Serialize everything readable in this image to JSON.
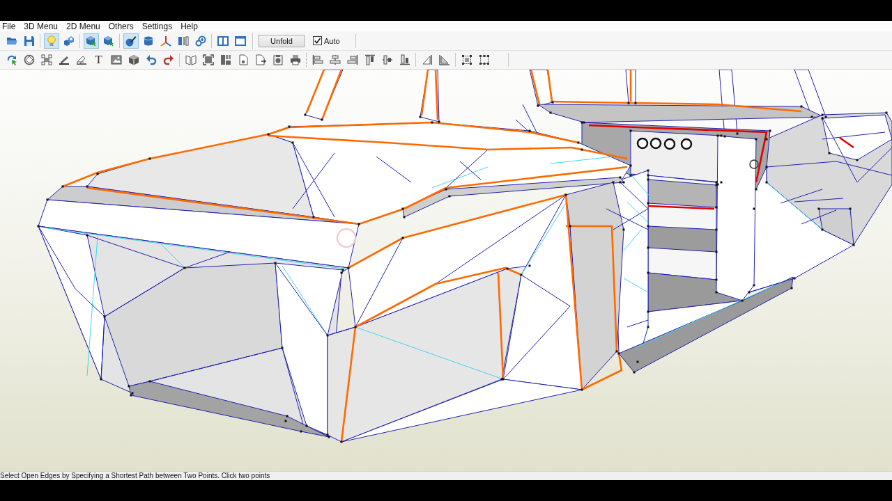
{
  "menu_bar": {
    "items": [
      "File",
      "3D Menu",
      "2D Menu",
      "Others",
      "Settings",
      "Help"
    ]
  },
  "toolbar_top": {
    "buttons": [
      {
        "selected": false
      },
      {
        "selected": false
      },
      {
        "selected": true
      },
      {
        "selected": false
      },
      {
        "selected": true
      },
      {
        "selected": false
      },
      {
        "selected": true
      },
      {
        "selected": false
      },
      {
        "selected": false
      },
      {
        "selected": false
      },
      {
        "selected": false
      },
      {
        "selected": false
      },
      {
        "selected": false
      }
    ],
    "unfold_button": "Unfold",
    "auto_checkbox": {
      "label": "Auto",
      "checked": true
    }
  },
  "toolbar_bottom": {
    "text_button": "T"
  },
  "status_bar": {
    "text": "Select Open Edges by Specifying a Shortest Path between Two Points. Click two points"
  }
}
